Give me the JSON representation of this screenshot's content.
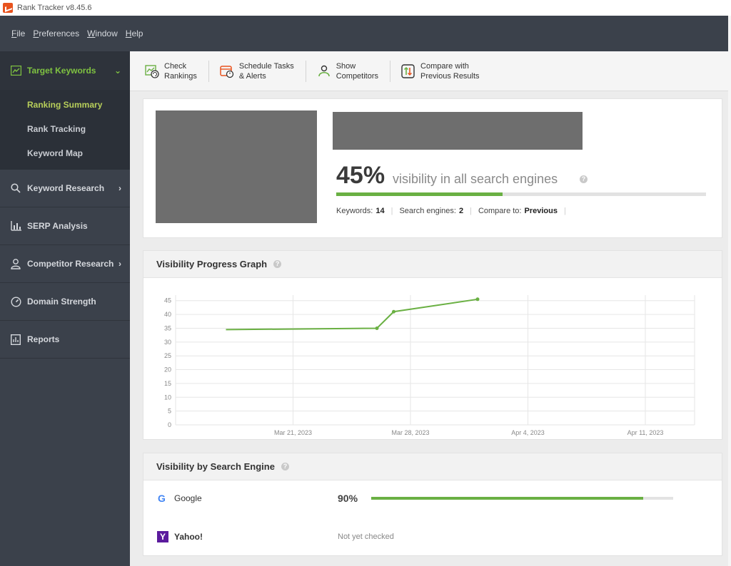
{
  "window": {
    "title": "Rank Tracker v8.45.6"
  },
  "menu": [
    {
      "accel": "F",
      "rest": "ile"
    },
    {
      "accel": "P",
      "rest": "references"
    },
    {
      "accel": "W",
      "rest": "indow"
    },
    {
      "accel": "H",
      "rest": "elp"
    }
  ],
  "sidebar": {
    "active_section": "Target Keywords",
    "submenu": [
      "Ranking Summary",
      "Rank Tracking",
      "Keyword Map"
    ],
    "sections": [
      "Keyword Research",
      "SERP Analysis",
      "Competitor Research",
      "Domain Strength",
      "Reports"
    ]
  },
  "toolbar": {
    "check_1": "Check",
    "check_2": "Rankings",
    "schedule_1": "Schedule Tasks",
    "schedule_2": "& Alerts",
    "show_1": "Show",
    "show_2": "Competitors",
    "compare_1": "Compare with",
    "compare_2": "Previous Results"
  },
  "summary": {
    "visibility_pct": "45%",
    "visibility_fraction": 0.45,
    "visibility_text": "visibility in all search engines",
    "keywords_label": "Keywords:",
    "keywords_value": "14",
    "engines_label": "Search engines:",
    "engines_value": "2",
    "compare_label": "Compare to:",
    "compare_value": "Previous"
  },
  "graph_panel": {
    "title": "Visibility Progress Graph"
  },
  "chart_data": {
    "type": "line",
    "x": [
      "2023-03-17",
      "2023-03-26",
      "2023-03-27",
      "2023-04-01"
    ],
    "values": [
      34.5,
      35,
      41,
      45.5
    ],
    "y_ticks": [
      "0",
      "5",
      "10",
      "15",
      "20",
      "25",
      "30",
      "35",
      "40",
      "45"
    ],
    "x_ticks": [
      "Mar 21, 2023",
      "Mar 28, 2023",
      "Apr 4, 2023",
      "Apr 11, 2023"
    ],
    "ylim": [
      0,
      47
    ],
    "grid": true,
    "color": "#6ab043"
  },
  "engines_panel": {
    "title": "Visibility by Search Engine",
    "google_name": "Google",
    "google_pct": "90%",
    "google_fraction": 0.9,
    "yahoo_name": "Yahoo!",
    "yahoo_note": "Not yet checked"
  }
}
